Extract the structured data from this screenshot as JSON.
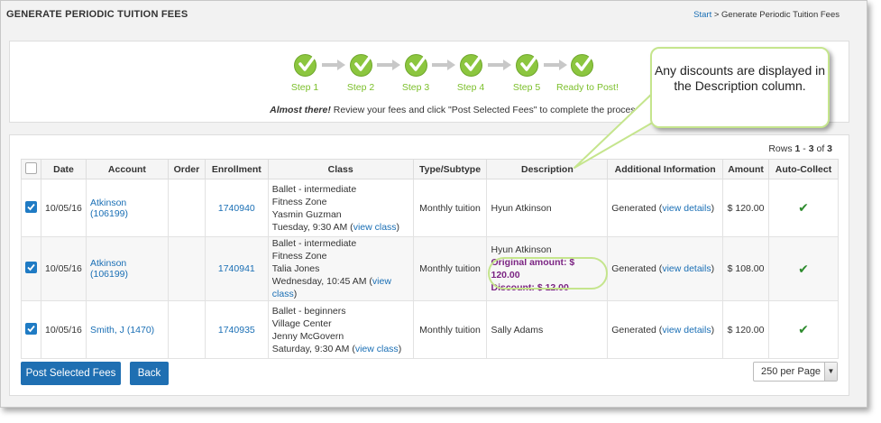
{
  "header": {
    "title": "GENERATE PERIODIC TUITION FEES",
    "breadcrumb_start": "Start",
    "breadcrumb_sep": " > ",
    "breadcrumb_current": "Generate Periodic Tuition Fees"
  },
  "steps": {
    "items": [
      "Step 1",
      "Step 2",
      "Step 3",
      "Step 4",
      "Step 5",
      "Ready to Post!"
    ],
    "message_bold": "Almost there!",
    "message_rest": " Review your fees and click \"Post Selected Fees\" to complete the process."
  },
  "callout": {
    "text": "Any discounts are displayed in the Description column."
  },
  "table": {
    "rows_prefix": "Rows ",
    "rows_from": "1",
    "rows_dash": " - ",
    "rows_to": "3",
    "rows_of": " of ",
    "rows_total": "3",
    "columns": [
      "",
      "Date",
      "Account",
      "Order",
      "Enrollment",
      "Class",
      "Type/Subtype",
      "Description",
      "Additional Information",
      "Amount",
      "Auto-Collect"
    ],
    "rows": [
      {
        "date": "10/05/16",
        "account": "Atkinson (106199)",
        "order": "",
        "enrollment": "1740940",
        "class_name": "Ballet - intermediate",
        "location": "Fitness Zone",
        "instructor": "Yasmin Guzman",
        "schedule": "Tuesday, 9:30 AM (",
        "view_class": "view class",
        "close_paren": ")",
        "type": "Monthly tuition",
        "description": "Hyun Atkinson",
        "info_prefix": "Generated (",
        "view_details": "view details",
        "info_suffix": ")",
        "amount": "$ 120.00"
      },
      {
        "date": "10/05/16",
        "account": "Atkinson (106199)",
        "order": "",
        "enrollment": "1740941",
        "class_name": "Ballet - intermediate",
        "location": "Fitness Zone",
        "instructor": "Talia Jones",
        "schedule": "Wednesday, 10:45 AM (",
        "view_class": "view class",
        "close_paren": ")",
        "type": "Monthly tuition",
        "description": "Hyun Atkinson",
        "original_amount": "Original amount: $ 120.00",
        "discount": "Discount: $ 12.00",
        "info_prefix": "Generated (",
        "view_details": "view details",
        "info_suffix": ")",
        "amount": "$ 108.00"
      },
      {
        "date": "10/05/16",
        "account": "Smith, J (1470)",
        "order": "",
        "enrollment": "1740935",
        "class_name": "Ballet - beginners",
        "location": "Village Center",
        "instructor": "Jenny McGovern",
        "schedule": "Saturday, 9:30 AM (",
        "view_class": "view class",
        "close_paren": ")",
        "type": "Monthly tuition",
        "description": "Sally Adams",
        "info_prefix": "Generated (",
        "view_details": "view details",
        "info_suffix": ")",
        "amount": "$ 120.00"
      }
    ]
  },
  "footer": {
    "post_label": "Post Selected Fees",
    "back_label": "Back",
    "per_page": "250 per Page"
  },
  "colors": {
    "accent_blue": "#1f6fb2",
    "step_green": "#8cc63f",
    "discount_purple": "#7b2483",
    "callout_border": "#c5e58d"
  }
}
